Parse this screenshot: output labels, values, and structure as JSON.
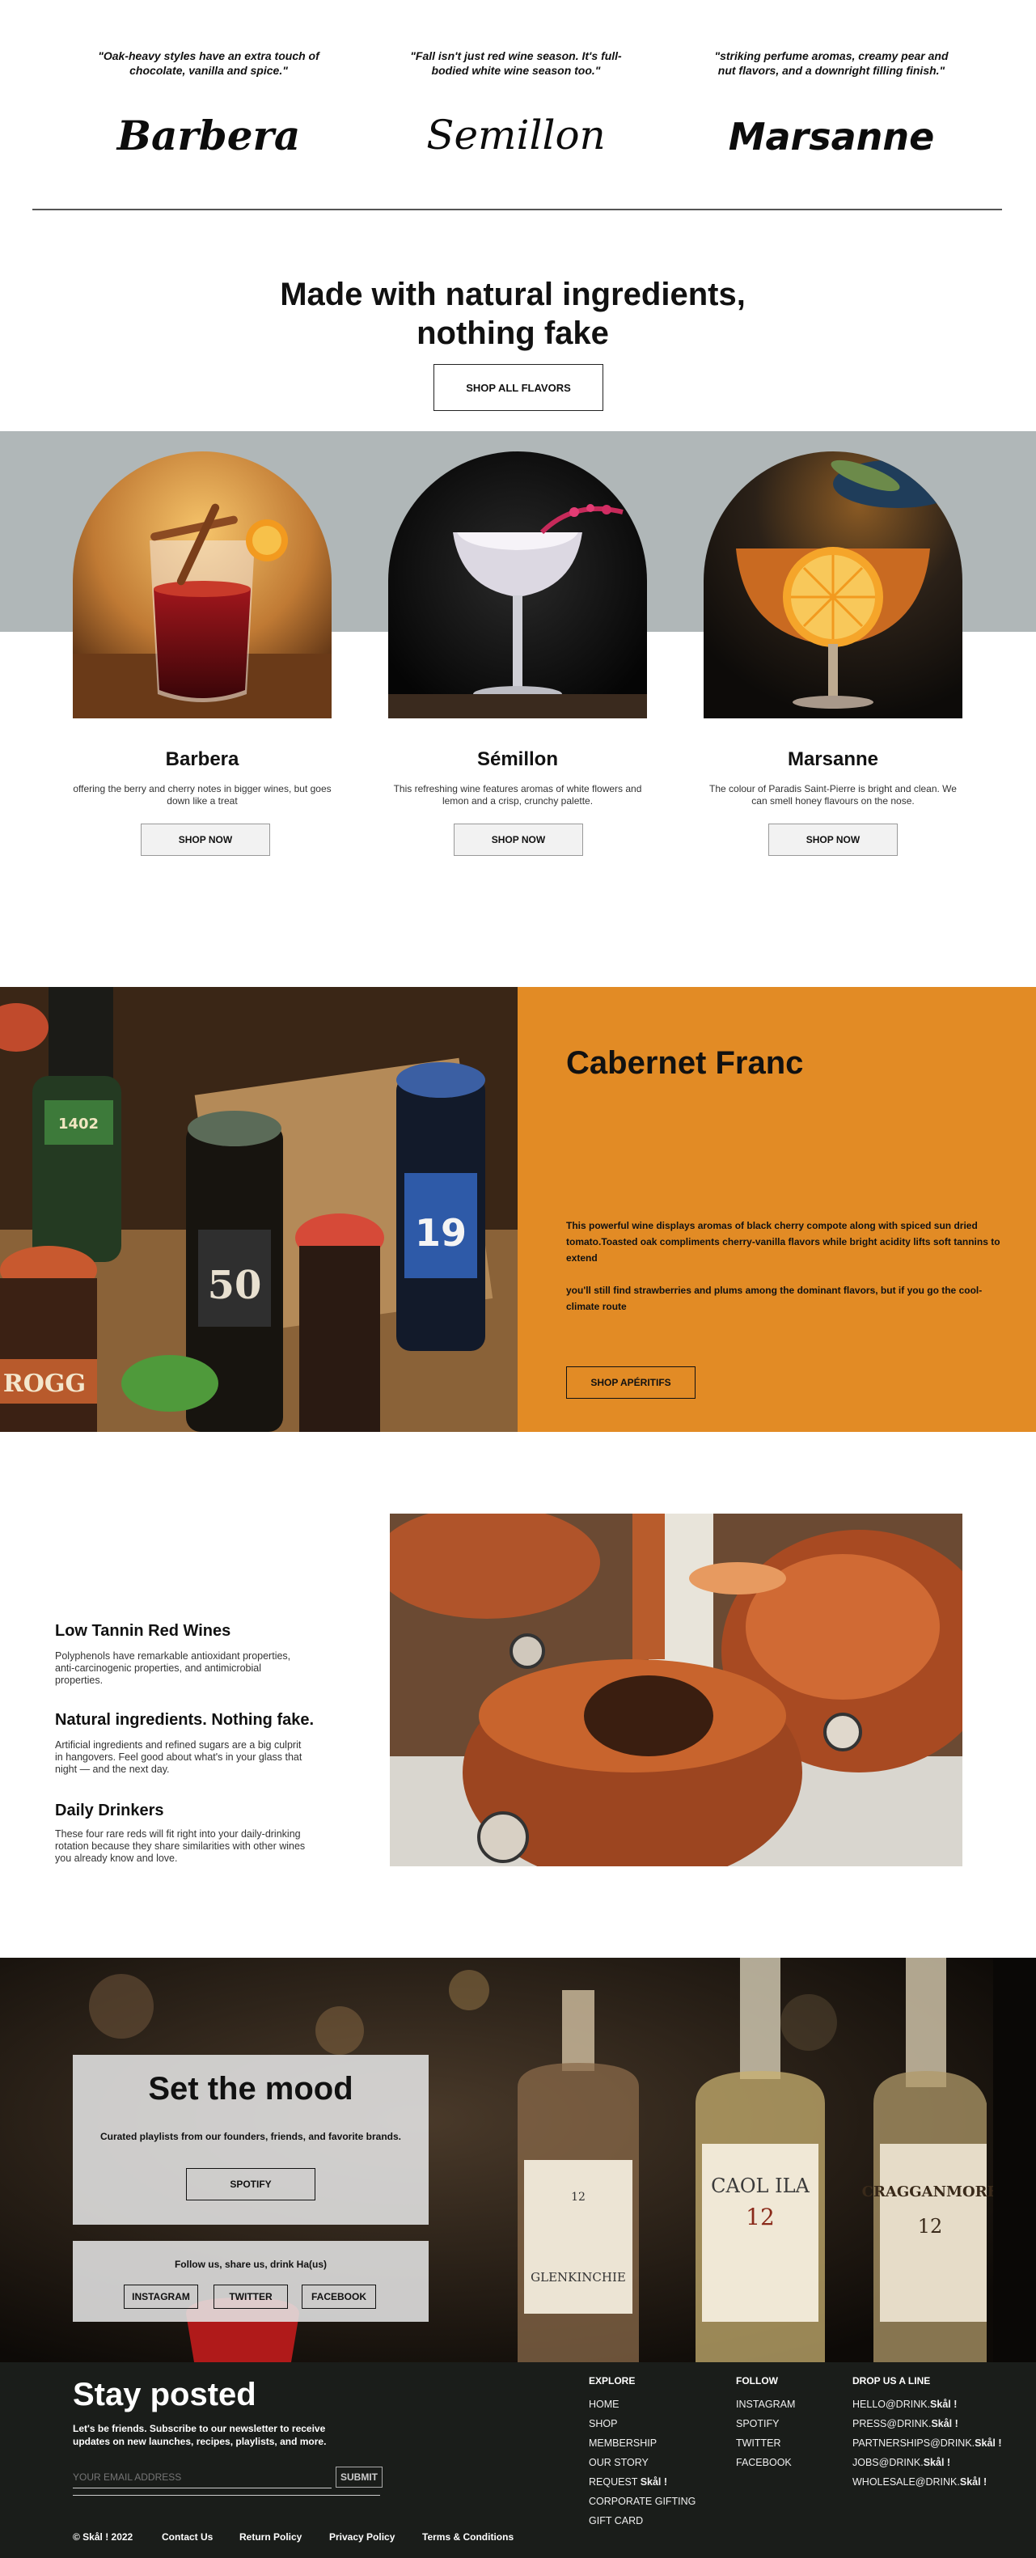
{
  "testimonials": [
    {
      "quote": "\"Oak-heavy styles have an extra touch of chocolate, vanilla and spice.\"",
      "logo": "Barbera"
    },
    {
      "quote": "\"Fall isn't just red wine season. It's full-bodied white wine season too.\"",
      "logo": "Semillon"
    },
    {
      "quote": "\"striking perfume aromas, creamy pear and nut flavors, and a downright filling finish.\"",
      "logo": "Marsanne"
    }
  ],
  "hero": {
    "heading_line1": "Made with natural ingredients,",
    "heading_line2": "nothing fake",
    "button": "SHOP ALL FLAVORS"
  },
  "products": [
    {
      "name": "Barbera",
      "desc": "offering the berry and cherry notes in bigger wines, but goes down like a treat",
      "button": "SHOP NOW"
    },
    {
      "name": "Sémillon",
      "desc": "This refreshing wine features aromas of white flowers and lemon and a crisp, crunchy palette.",
      "button": "SHOP NOW"
    },
    {
      "name": "Marsanne",
      "desc": "The colour of Paradis Saint-Pierre is bright and clean. We can smell honey flavours on the nose.",
      "button": "SHOP NOW"
    }
  ],
  "feature_wine": {
    "title": "Cabernet Franc",
    "para1": "This powerful wine displays aromas of black cherry compote along with spiced sun dried tomato.Toasted oak compliments cherry-vanilla flavors while bright acidity lifts soft tannins to extend",
    "para2": "you'll still find strawberries and plums among the dominant flavors, but if you go the cool-climate route",
    "button": "SHOP APÉRITIFS",
    "bottle_labels": [
      "50",
      "19",
      "ROGG",
      "1402"
    ]
  },
  "features": [
    {
      "title": "Low Tannin Red Wines",
      "text": "Polyphenols have remarkable antioxidant properties, anti-carcinogenic properties, and antimicrobial properties."
    },
    {
      "title": "Natural ingredients. Nothing fake.",
      "text": "Artificial ingredients and refined sugars are a big culprit in hangovers. Feel good about what's in your glass that night — and the next day."
    },
    {
      "title": "Daily Drinkers",
      "text": "These four rare reds will fit right into your daily-drinking rotation because they share similarities with other wines you already know and love."
    }
  ],
  "mood": {
    "title": "Set the mood",
    "subtitle": "Curated playlists from our founders, friends, and favorite brands.",
    "spotify_button": "SPOTIFY",
    "follow_text": "Follow us, share us, drink Ha(us)",
    "social_buttons": [
      "INSTAGRAM",
      "TWITTER",
      "FACEBOOK"
    ],
    "bottle_labels": [
      "GLENKINCHIE",
      "CAOL ILA",
      "CRAGGANMORE",
      "12",
      "12",
      "12"
    ]
  },
  "footer": {
    "title": "Stay posted",
    "subtitle": "Let's be friends. Subscribe to our newsletter to receive updates on new launches, recipes, playlists, and more.",
    "email_placeholder": "YOUR EMAIL ADDRESS",
    "submit": "SUBMIT",
    "bottom_links": [
      "© Skål ! 2022",
      "Contact Us",
      "Return Policy",
      "Privacy Policy",
      "Terms & Conditions"
    ],
    "explore_heading": "EXPLORE",
    "explore": [
      "HOME",
      "SHOP",
      "MEMBERSHIP",
      "OUR STORY",
      "REQUEST",
      "CORPORATE GIFTING",
      "GIFT CARD"
    ],
    "request_suffix": "Skål !",
    "follow_heading": "FOLLOW",
    "follow": [
      "INSTAGRAM",
      "SPOTIFY",
      "TWITTER",
      "FACEBOOK"
    ],
    "contact_heading": "DROP US A LINE",
    "contact": [
      "HELLO@DRINK.",
      "PRESS@DRINK.",
      "PARTNERSHIPS@DRINK.",
      "JOBS@DRINK.",
      "WHOLESALE@DRINK."
    ],
    "brand_suffix": "Skål !"
  },
  "colors": {
    "band": "#b0b7b8",
    "orange": "#e28b25",
    "footer": "#1a1d1a"
  }
}
